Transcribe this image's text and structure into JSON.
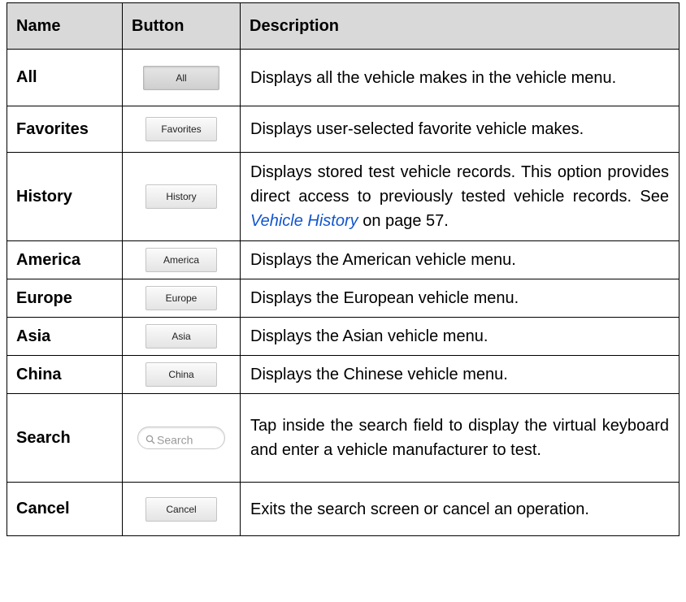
{
  "table": {
    "headers": {
      "name": "Name",
      "button": "Button",
      "description": "Description"
    },
    "rows": [
      {
        "name": "All",
        "button": "All",
        "desc": "Displays all the vehicle makes in the vehicle menu."
      },
      {
        "name": "Favorites",
        "button": "Favorites",
        "desc": "Displays user-selected favorite vehicle makes."
      },
      {
        "name": "History",
        "button": "History",
        "desc_before": "Displays stored test vehicle records. This option provides direct access to previously tested vehicle records. See ",
        "desc_link": "Vehicle History",
        "desc_after": " on page 57."
      },
      {
        "name": "America",
        "button": "America",
        "desc": "Displays the American vehicle menu."
      },
      {
        "name": "Europe",
        "button": "Europe",
        "desc": "Displays the European vehicle menu."
      },
      {
        "name": "Asia",
        "button": "Asia",
        "desc": "Displays the Asian vehicle menu."
      },
      {
        "name": "China",
        "button": "China",
        "desc": "Displays the Chinese vehicle menu."
      },
      {
        "name": "Search",
        "button": "Search",
        "button_icon": "search-icon",
        "desc": "Tap inside the search field to display the virtual keyboard and enter a vehicle manufacturer to test."
      },
      {
        "name": "Cancel",
        "button": "Cancel",
        "desc": "Exits the search screen or cancel an operation."
      }
    ]
  },
  "colors": {
    "header_bg": "#d9d9d9",
    "link": "#1155cc",
    "border": "#000000"
  }
}
